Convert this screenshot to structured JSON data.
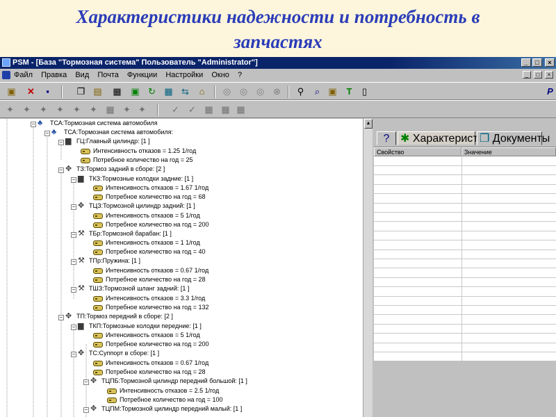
{
  "slide": {
    "title_line1": "Характеристики надежности и потребность в",
    "title_line2": "запчастях"
  },
  "window": {
    "title": "PSM - [База \"Тормозная система\" Пользователь \"Administrator\"]",
    "controls": [
      "_",
      "□",
      "×"
    ]
  },
  "menubar": {
    "items": [
      "Файл",
      "Правка",
      "Вид",
      "Почта",
      "Функции",
      "Настройки",
      "Окно",
      "?"
    ],
    "mdi_controls": [
      "_",
      "□",
      "×"
    ]
  },
  "toolbar1": {
    "icons": [
      "properties-icon",
      "delete-icon",
      "save-icon",
      "copy-icon",
      "paste-icon",
      "document-icon",
      "refresh-icon",
      "export-icon",
      "import-icon",
      "home-icon",
      "nav-icon",
      "nav-icon",
      "nav-icon",
      "stop-icon",
      "find-icon",
      "zoom-icon",
      "filter-icon",
      "tool-icon",
      "book-icon"
    ],
    "brand_letter": "P"
  },
  "toolbar2": {
    "icons": [
      "tool-icon",
      "tool-icon",
      "tool-icon",
      "tool-icon",
      "tool-icon",
      "tool-icon",
      "tool-icon",
      "tool-icon",
      "check-icon",
      "check-icon",
      "check-icon",
      "check-icon"
    ]
  },
  "tree": {
    "nodes": [
      {
        "text": "ТСА:Тормозная система автомобиля",
        "kind": "root"
      },
      {
        "text": "ТСА:Тормозная система автомобиля:",
        "kind": "asm"
      },
      {
        "text": "ГЦ:Главный цилиндр: [1 ]",
        "kind": "part"
      },
      {
        "text": "Интенсивность отказов = 1.25 1/год",
        "kind": "attr"
      },
      {
        "text": "Потребное количество на год = 25",
        "kind": "attr"
      },
      {
        "text": "ТЗ:Тормоз задний в сборе: [2 ]",
        "kind": "asm"
      },
      {
        "text": "ТКЗ:Тормозные колодки задние: [1 ]",
        "kind": "part"
      },
      {
        "text": "Интенсивность отказов = 1.67 1/год",
        "kind": "attr"
      },
      {
        "text": "Потребное количество на год = 68",
        "kind": "attr"
      },
      {
        "text": "ТЦЗ:Тормозной цилиндр задний: [1 ]",
        "kind": "asm"
      },
      {
        "text": "Интенсивность отказов = 5 1/год",
        "kind": "attr"
      },
      {
        "text": "Потребное количество на год = 200",
        "kind": "attr"
      },
      {
        "text": "ТБр:Тормозной барабан: [1 ]",
        "kind": "part"
      },
      {
        "text": "Интенсивность отказов = 1 1/год",
        "kind": "attr"
      },
      {
        "text": "Потребное количество на год = 40",
        "kind": "attr"
      },
      {
        "text": "ТПр:Пружина: [1 ]",
        "kind": "part"
      },
      {
        "text": "Интенсивность отказов = 0.67 1/год",
        "kind": "attr"
      },
      {
        "text": "Потребное количество на год = 28",
        "kind": "attr"
      },
      {
        "text": "ТШЗ:Тормозной шланг задний: [1 ]",
        "kind": "part"
      },
      {
        "text": "Интенсивность отказов = 3.3 1/год",
        "kind": "attr"
      },
      {
        "text": "Потребное количество на год = 132",
        "kind": "attr"
      },
      {
        "text": "ТП:Тормоз передний в сборе: [2 ]",
        "kind": "asm"
      },
      {
        "text": "ТКП:Тормозные колодки передние: [1 ]",
        "kind": "part"
      },
      {
        "text": "Интенсивность отказов = 5 1/год",
        "kind": "attr"
      },
      {
        "text": "Потребное количество на год = 200",
        "kind": "attr"
      },
      {
        "text": "ТС:Суппорт в сборе: [1 ]",
        "kind": "asm"
      },
      {
        "text": "Интенсивность отказов = 0.67 1/год",
        "kind": "attr"
      },
      {
        "text": "Потребное количество на год = 28",
        "kind": "attr"
      },
      {
        "text": "ТЦПБ:Тормозной цилиндр передний большой: [1 ]",
        "kind": "asm"
      },
      {
        "text": "Интенсивность отказов = 2.5 1/год",
        "kind": "attr"
      },
      {
        "text": "Потребное количество на год = 100",
        "kind": "attr"
      },
      {
        "text": "ТЦПМ:Тормозной цилиндр передний малый: [1 ]",
        "kind": "asm"
      }
    ]
  },
  "right_panel": {
    "help_tab": "?",
    "tab_characteristics": "Характеристики",
    "tab_documents": "Документы",
    "col_property": "Свойство",
    "col_value": "Значение"
  }
}
